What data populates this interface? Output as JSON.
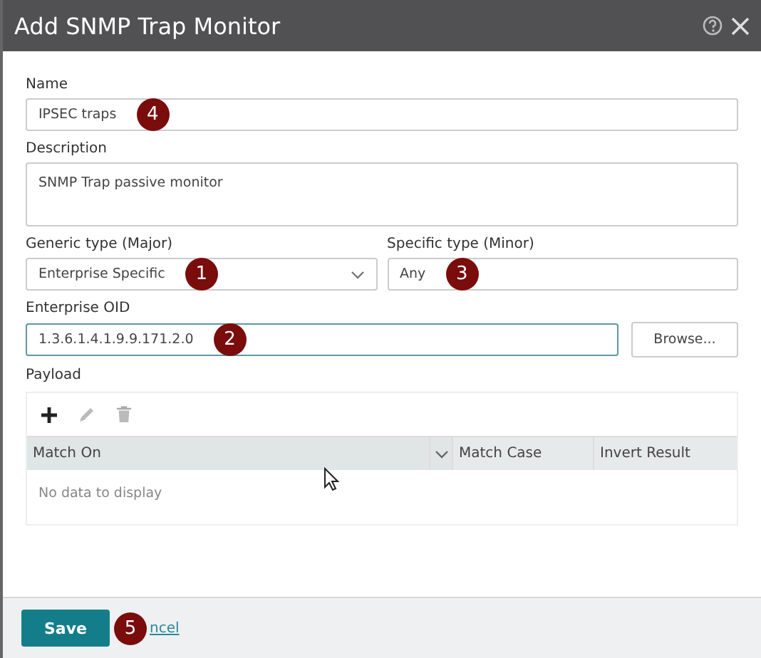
{
  "window": {
    "title": "Add SNMP Trap Monitor"
  },
  "fields": {
    "name": {
      "label": "Name",
      "value": "IPSEC traps",
      "callout": "4"
    },
    "description": {
      "label": "Description",
      "value": "SNMP Trap passive monitor"
    },
    "generic_type": {
      "label": "Generic type (Major)",
      "value": "Enterprise Specific",
      "callout": "1"
    },
    "specific_type": {
      "label": "Specific type (Minor)",
      "value": "Any",
      "callout": "3"
    },
    "enterprise_oid": {
      "label": "Enterprise OID",
      "value": "1.3.6.1.4.1.9.9.171.2.0",
      "callout": "2",
      "focused": true,
      "button": "Browse..."
    }
  },
  "payload": {
    "label": "Payload",
    "columns": [
      "Match On",
      "Match Case",
      "Invert Result"
    ],
    "empty_text": "No data to display"
  },
  "footer": {
    "save": "Save",
    "cancel": "ncel",
    "callout": "5"
  }
}
